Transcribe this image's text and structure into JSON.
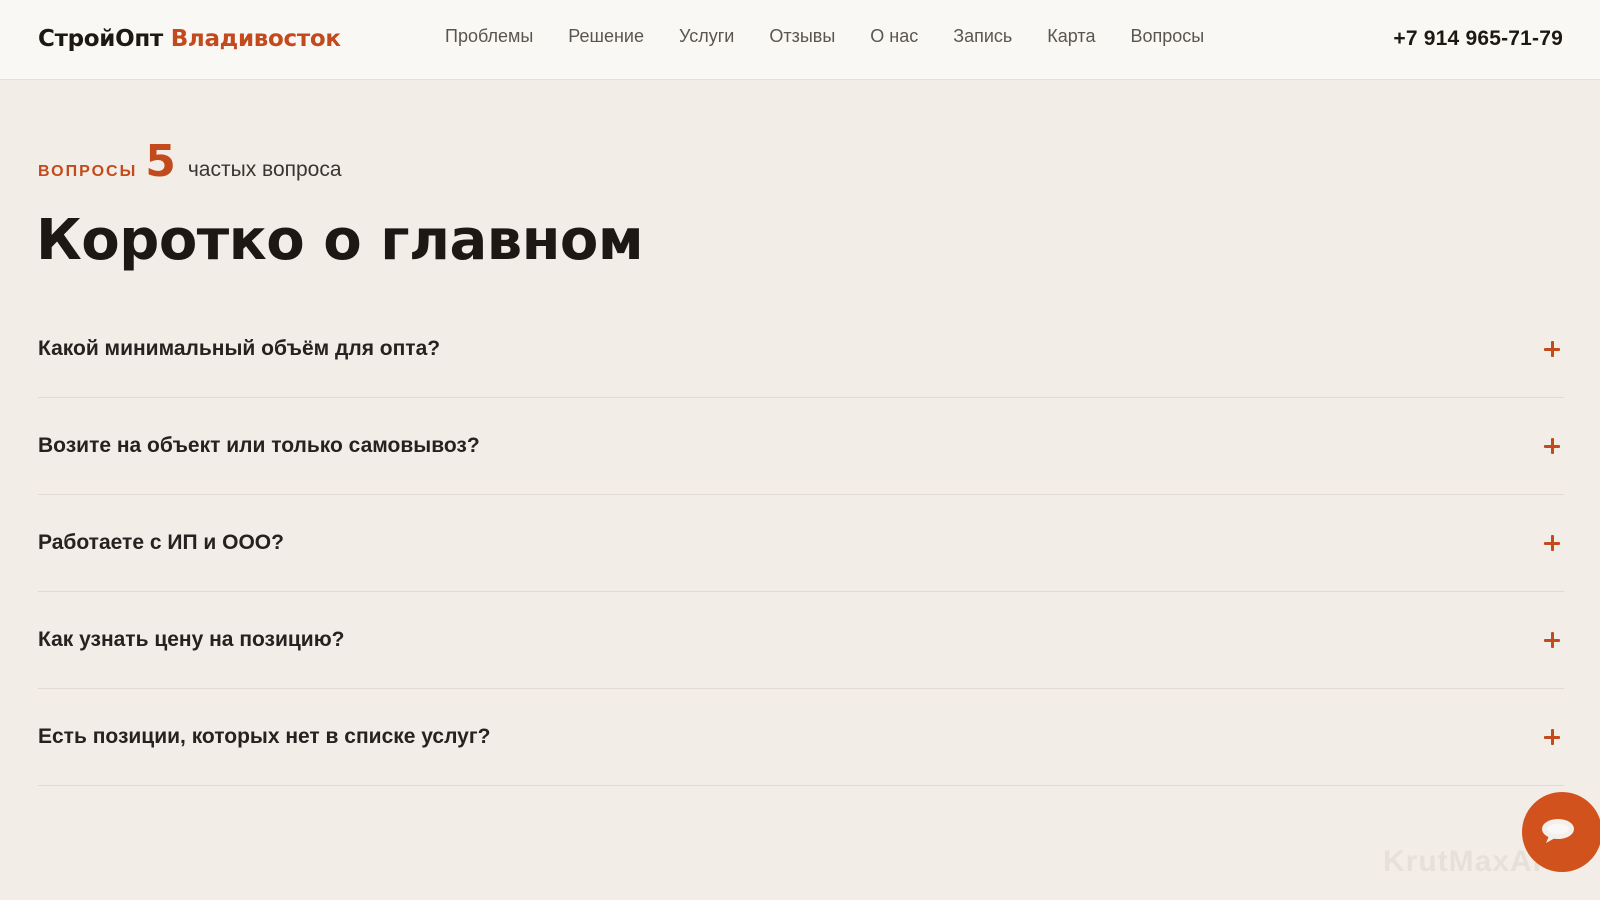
{
  "header": {
    "logo_main": "СтройОпт",
    "logo_city": "Владивосток",
    "nav": [
      {
        "label": "Проблемы"
      },
      {
        "label": "Решение"
      },
      {
        "label": "Услуги"
      },
      {
        "label": "Отзывы"
      },
      {
        "label": "О нас"
      },
      {
        "label": "Запись"
      },
      {
        "label": "Карта"
      },
      {
        "label": "Вопросы"
      }
    ],
    "phone": "+7 914 965-71-79"
  },
  "faq_section": {
    "eyebrow_label": "Вопросы",
    "eyebrow_count": "5",
    "eyebrow_text": "частых вопроса",
    "title": "Коротко о главном",
    "items": [
      {
        "question": "Какой минимальный объём для опта?"
      },
      {
        "question": "Возите на объект или только самовывоз?"
      },
      {
        "question": "Работаете с ИП и ООО?"
      },
      {
        "question": "Как узнать цену на позицию?"
      },
      {
        "question": "Есть позиции, которых нет в списке услуг?"
      }
    ]
  },
  "watermark": "KrutMaxAI",
  "icons": {
    "expand": "plus-icon",
    "chat": "chat-bubble-icon"
  },
  "colors": {
    "accent": "#c24a1c",
    "background": "#f2ede6",
    "header_bg": "#faf8f4",
    "text": "#1c1814"
  }
}
